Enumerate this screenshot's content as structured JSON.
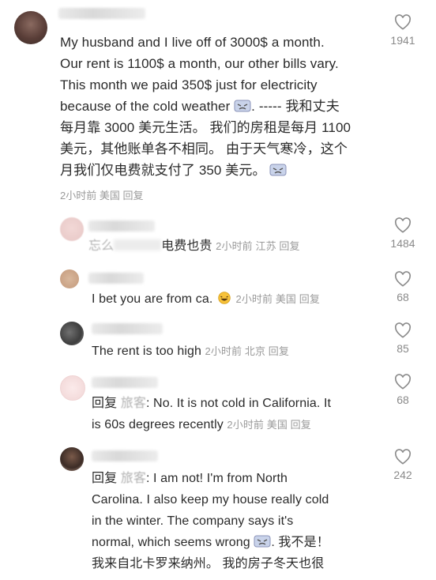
{
  "comments": [
    {
      "text_line1": "My husband and I live off of 3000$ a month.",
      "text_line2": "Our rent is 1100$ a month, our other bills vary.",
      "text_line3": "This month we paid 350$ just for electricity",
      "text_line4_a": "because of the cold weather",
      "text_line4_b": ". -----  我和丈夫",
      "text_line5": "每月靠 3000 美元生活。 我们的房租是每月 1100",
      "text_line6": "美元，其他账单各不相同。 由于天气寒冷，这个",
      "text_line7": "月我们仅电费就支付了 350 美元。",
      "meta": "2小时前 美国  回复",
      "likes": "1941"
    },
    {
      "text_partial": "忘么",
      "text": "电费也贵",
      "meta": "2小时前  江苏  回复",
      "likes": "1484"
    },
    {
      "text": "I bet you are from ca.",
      "meta": "2小时前  美国  回复",
      "likes": "68"
    },
    {
      "text": "The rent is too high",
      "meta": "2小时前  北京  回复",
      "likes": "85"
    },
    {
      "reply_prefix": "回复",
      "mention": "旅客",
      "text_line1": ": No. It is not cold in California. It",
      "text_line2": "is 60s degrees recently",
      "meta": "2小时前  美国  回复",
      "likes": "68"
    },
    {
      "reply_prefix": "回复",
      "mention": "旅客",
      "text_line1": ": I am not! I'm from North",
      "text_line2": "Carolina. I also keep my house really cold",
      "text_line3": "in the winter. The company says it's",
      "text_line4_a": "normal, which seems wrong",
      "text_line4_b": ". 我不是！",
      "text_line5": "我来自北卡罗来纳州。 我的房子冬天也很",
      "likes": "242"
    }
  ],
  "icons": {
    "like": "heart-outline-icon",
    "emoji_tired": "tired-face-emoji",
    "emoji_laugh": "laughing-emoji"
  },
  "colors": {
    "text": "#2a2a2a",
    "meta": "#9a9a9a",
    "heart": "#8a8a8a"
  }
}
